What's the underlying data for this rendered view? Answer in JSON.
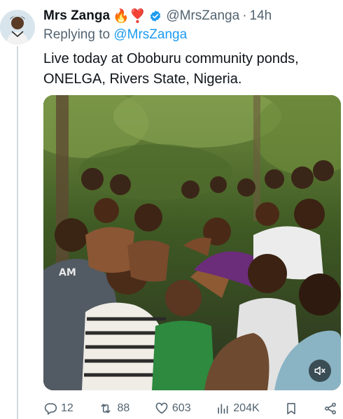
{
  "tweet": {
    "author_name": "Mrs Zanga",
    "author_emojis": "🔥❣️",
    "handle": "@MrsZanga",
    "separator": "·",
    "time": "14h",
    "replying_prefix": "Replying to",
    "replying_to": "@MrsZanga",
    "text": "Live today at Oboburu community ponds, ONELGA, Rivers State, Nigeria.",
    "media": {
      "type": "video",
      "muted_icon": "speaker-mute-icon"
    }
  },
  "actions": {
    "replies": "12",
    "retweets": "88",
    "likes": "603",
    "views": "204K"
  },
  "colors": {
    "accent": "#1d9bf0",
    "secondary_text": "#536471",
    "verified": "#1d9bf0"
  }
}
